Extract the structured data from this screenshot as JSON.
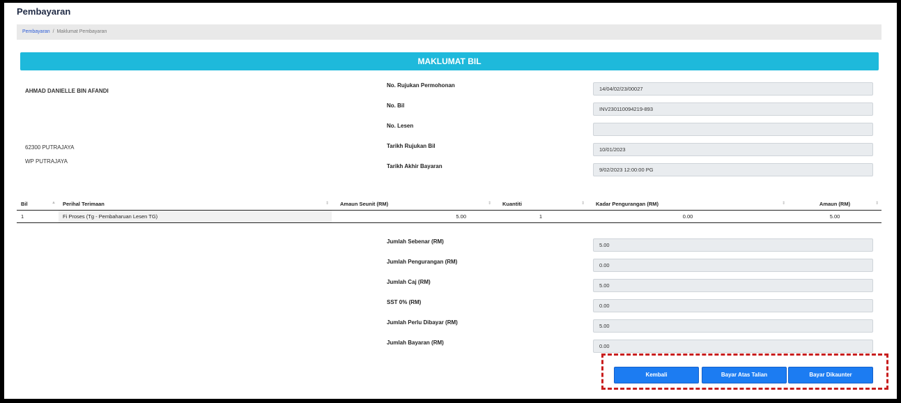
{
  "page": {
    "title": "Pembayaran"
  },
  "breadcrumb": {
    "link": "Pembayaran",
    "separator": "/",
    "current": "Maklumat Pembayaran"
  },
  "banner": "MAKLUMAT BIL",
  "customer": {
    "name": "AHMAD DANIELLE BIN AFANDI",
    "postcode_city": "62300 PUTRAJAYA",
    "state": "WP PUTRAJAYA"
  },
  "bill_info": [
    {
      "label": "No. Rujukan Permohonan",
      "value": "14/04/02/23/00027"
    },
    {
      "label": "No. Bil",
      "value": "INV230110094219-893"
    },
    {
      "label": "No. Lesen",
      "value": ""
    },
    {
      "label": "Tarikh Rujukan Bil",
      "value": "10/01/2023"
    },
    {
      "label": "Tarikh Akhir Bayaran",
      "value": "9/02/2023 12:00:00 PG"
    }
  ],
  "table": {
    "headers": [
      "Bil",
      "Perihal Terimaan",
      "Amaun Seunit (RM)",
      "Kuantiti",
      "Kadar Pengurangan (RM)",
      "Amaun (RM)"
    ],
    "rows": [
      [
        "1",
        "Fi Proses (Tg - Pembaharuan Lesen TG)",
        "5.00",
        "1",
        "0.00",
        "5.00"
      ]
    ]
  },
  "totals": [
    {
      "label": "Jumlah Sebenar (RM)",
      "value": "5.00"
    },
    {
      "label": "Jumlah Pengurangan (RM)",
      "value": "0.00"
    },
    {
      "label": "Jumlah Caj (RM)",
      "value": "5.00"
    },
    {
      "label": "SST 0% (RM)",
      "value": "0.00"
    },
    {
      "label": "Jumlah Perlu Dibayar (RM)",
      "value": "5.00"
    },
    {
      "label": "Jumlah Bayaran (RM)",
      "value": "0.00"
    }
  ],
  "buttons": {
    "back": "Kembali",
    "pay_online": "Bayar Atas Talian",
    "pay_counter": "Bayar Dikaunter"
  },
  "colors": {
    "banner": "#1eb9db",
    "button": "#1c7cf2",
    "highlight": "#c81e1e"
  }
}
